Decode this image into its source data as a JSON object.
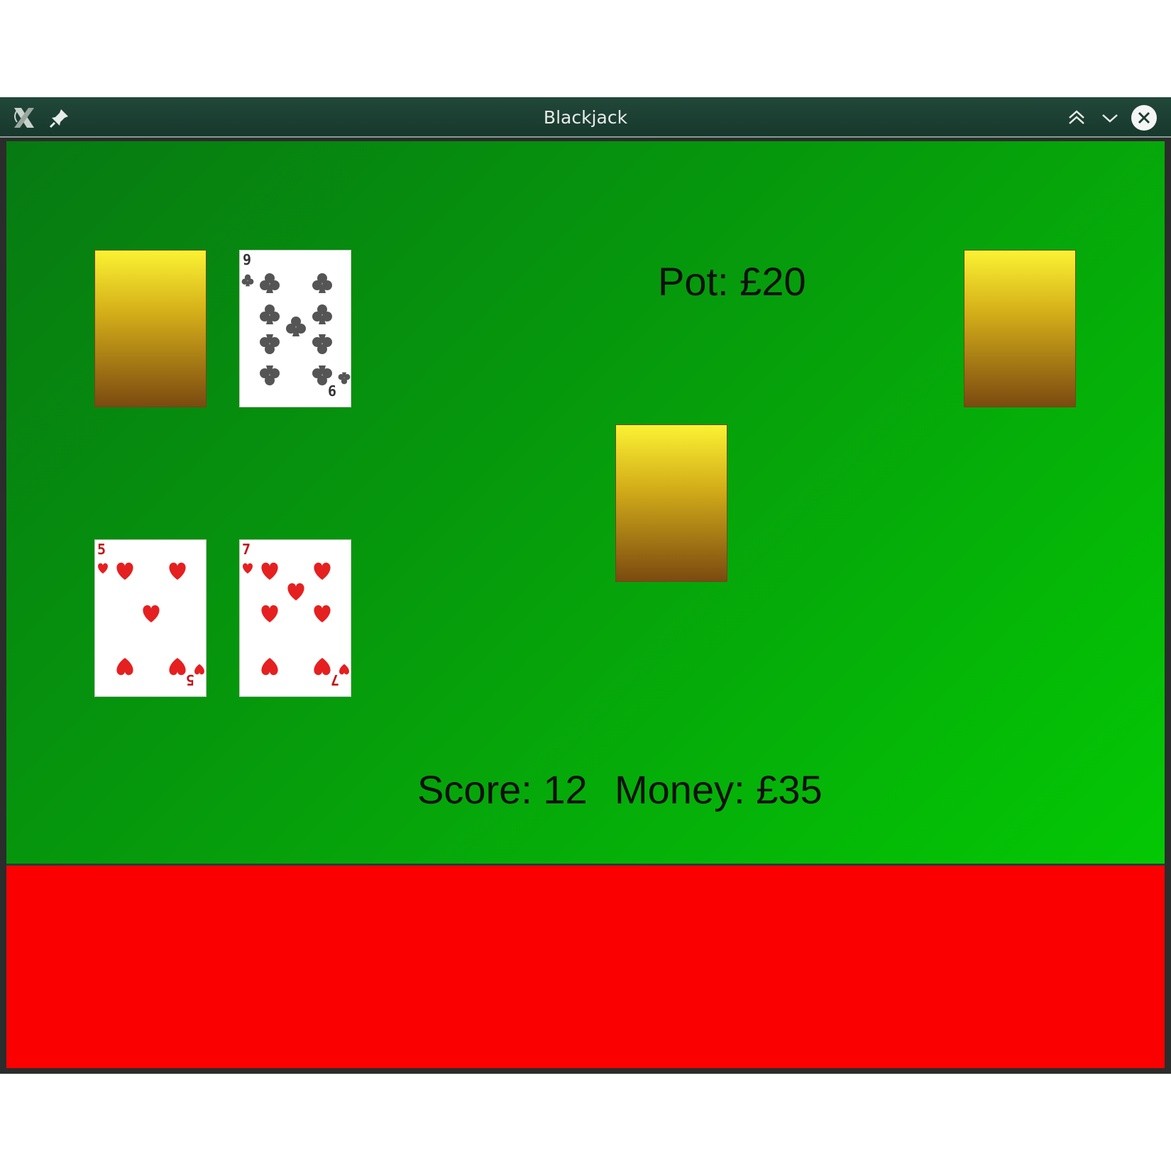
{
  "window": {
    "title": "Blackjack"
  },
  "titlebar_icons": {
    "app": "x-logo-icon",
    "pin": "pin-icon",
    "shade": "double-chevron-up-icon",
    "minimize": "chevron-down-icon",
    "close": "close-icon"
  },
  "table": {
    "pot": "Pot: £20",
    "score": "Score: 12",
    "money": "Money: £35"
  },
  "dealer_hand": [
    {
      "face": "down"
    },
    {
      "face": "up",
      "rank": "9",
      "suit": "clubs"
    }
  ],
  "player_hand": [
    {
      "face": "up",
      "rank": "5",
      "suit": "hearts"
    },
    {
      "face": "up",
      "rank": "7",
      "suit": "hearts"
    }
  ],
  "deck": {
    "face": "down"
  },
  "extra_card": {
    "face": "down"
  },
  "colors": {
    "felt_start": "#077a12",
    "felt_end": "#04c804",
    "bottom_bar": "#fa0000",
    "card_back_top": "#fbf233",
    "card_back_bottom": "#7b4a10",
    "heart_red": "#e52020",
    "club_dark": "#505050"
  }
}
